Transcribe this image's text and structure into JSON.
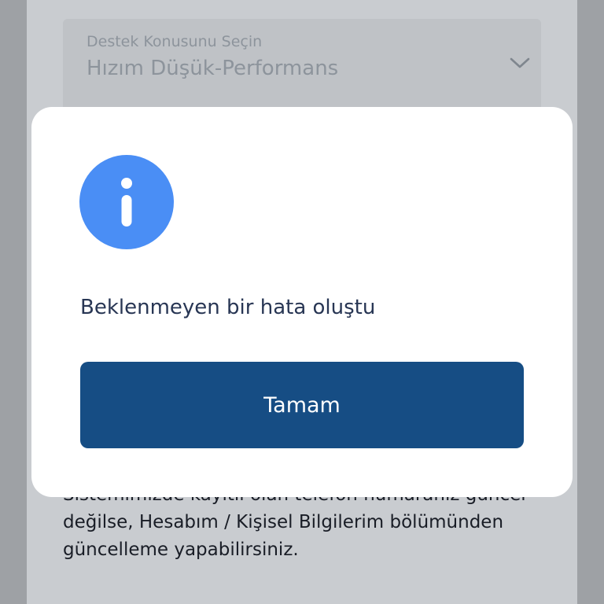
{
  "support_form": {
    "topic_select": {
      "label": "Destek Konusunu Seçin",
      "value": "Hızım Düşük-Performans"
    },
    "info_lines": [
      "Sistemimizde kayıtlı olan telefon numaranız güncel",
      "değilse, Hesabım / Kişisel Bilgilerim bölümünden",
      "güncelleme yapabilirsiniz."
    ]
  },
  "dialog": {
    "icon": "info-icon",
    "message": "Beklenmeyen bir hata oluştu",
    "ok_label": "Tamam"
  },
  "colors": {
    "accent_button": "#164d84",
    "info_icon": "#4a8ef5",
    "message_text": "#283654"
  }
}
